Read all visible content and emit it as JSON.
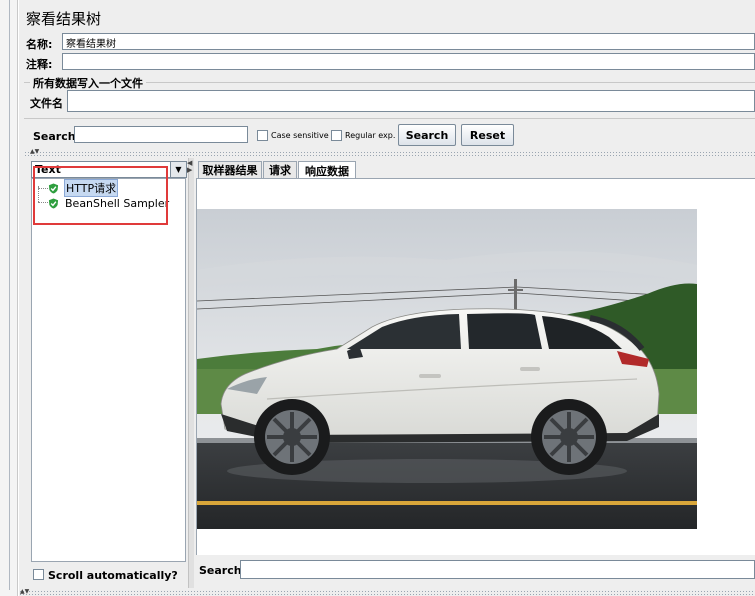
{
  "panel": {
    "title": "察看结果树",
    "name_label": "名称:",
    "name_value": "察看结果树",
    "comment_label": "注释:",
    "comment_value": ""
  },
  "file_section": {
    "title": "所有数据写入一个文件",
    "filename_label": "文件名",
    "filename_value": ""
  },
  "search_bar": {
    "label": "Search:",
    "value": "",
    "case_sensitive_label": "Case sensitive",
    "regex_label": "Regular exp.",
    "search_button": "Search",
    "reset_button": "Reset"
  },
  "renderer": {
    "selected": "Text"
  },
  "tree": {
    "items": [
      {
        "label": "HTTP请求",
        "status": "success",
        "selected": true
      },
      {
        "label": "BeanShell Sampler",
        "status": "success",
        "selected": false
      }
    ]
  },
  "scroll_auto_label": "Scroll automatically?",
  "tabs": [
    {
      "label": "取样器结果",
      "active": false
    },
    {
      "label": "请求",
      "active": false
    },
    {
      "label": "响应数据",
      "active": true
    }
  ],
  "bottom_search": {
    "label": "Search:",
    "value": ""
  },
  "colors": {
    "success_icon": "#2e9e3e",
    "highlight_border": "#e03a3a",
    "selection_bg": "#c6d9f1"
  }
}
